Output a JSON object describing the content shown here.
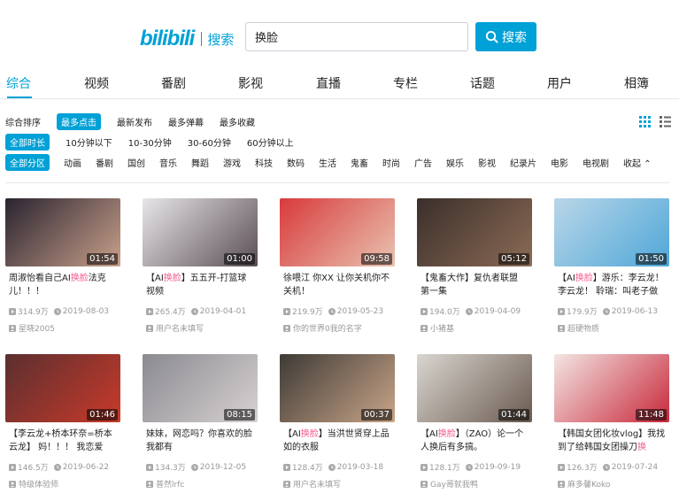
{
  "header": {
    "logo_text": "bilibili",
    "logo_suffix": "搜索",
    "search_value": "换脸",
    "search_button": "搜索"
  },
  "colors": {
    "accent": "#00a1d6",
    "highlight": "#f25d8e",
    "meta": "#999999"
  },
  "tabs": [
    {
      "label": "综合"
    },
    {
      "label": "视频"
    },
    {
      "label": "番剧"
    },
    {
      "label": "影视"
    },
    {
      "label": "直播"
    },
    {
      "label": "专栏"
    },
    {
      "label": "话题"
    },
    {
      "label": "用户"
    },
    {
      "label": "相簿"
    }
  ],
  "sort": [
    "综合排序",
    "最多点击",
    "最新发布",
    "最多弹幕",
    "最多收藏"
  ],
  "duration": [
    "全部时长",
    "10分钟以下",
    "10-30分钟",
    "30-60分钟",
    "60分钟以上"
  ],
  "categories": [
    "全部分区",
    "动画",
    "番剧",
    "国创",
    "音乐",
    "舞蹈",
    "游戏",
    "科技",
    "数码",
    "生活",
    "鬼畜",
    "时尚",
    "广告",
    "娱乐",
    "影视",
    "纪录片",
    "电影",
    "电视剧",
    "收起"
  ],
  "videos": [
    {
      "duration": "01:54",
      "title_pre": "周淑怡看自己AI",
      "title_hl": "换脸",
      "title_post": "法克儿！！！",
      "views": "314.9万",
      "date": "2019-08-03",
      "author": "星晓2005",
      "thumb_a": "#2a2430",
      "thumb_b": "#c9a08a"
    },
    {
      "duration": "01:00",
      "title_pre": "【AI",
      "title_hl": "换脸",
      "title_post": "】五五开-打篮球视频",
      "views": "265.4万",
      "date": "2019-04-01",
      "author": "用户名未填写",
      "thumb_a": "#e8e6ea",
      "thumb_b": "#5a4e55"
    },
    {
      "duration": "09:58",
      "title_pre": "徐喂江 你XX 让你关机你不关机！",
      "title_hl": "",
      "title_post": "",
      "views": "219.9万",
      "date": "2019-05-23",
      "author": "你的世界0我的名字",
      "thumb_a": "#d83a3c",
      "thumb_b": "#e9c3b0"
    },
    {
      "duration": "05:12",
      "title_pre": "【鬼畜大作】复仇者联盟 第一集",
      "title_hl": "",
      "title_post": "",
      "views": "194.0万",
      "date": "2019-04-09",
      "author": "小猪基",
      "thumb_a": "#3a2f2b",
      "thumb_b": "#8c6b55"
    },
    {
      "duration": "01:50",
      "title_pre": "【AI",
      "title_hl": "换脸",
      "title_post": "】游乐：李云龙！李云龙！ 聆瑞：叫老子做",
      "views": "179.9万",
      "date": "2019-06-13",
      "author": "超硬物质",
      "thumb_a": "#b9d6e8",
      "thumb_b": "#4fa7d8"
    },
    {
      "duration": "01:46",
      "title_pre": "【李云龙+桥本环奈=桥本云龙】 妈！！！ 我恋爱了!!!!!!",
      "title_hl": "",
      "title_post": "",
      "views": "146.5万",
      "date": "2019-06-22",
      "author": "特级体验师",
      "thumb_a": "#5b2f2f",
      "thumb_b": "#c93a2a"
    },
    {
      "duration": "08:15",
      "title_pre": "妹妹，网恋吗？你喜欢的脸我都有",
      "title_hl": "",
      "title_post": "",
      "views": "134.3万",
      "date": "2019-12-05",
      "author": "普然lrfc",
      "thumb_a": "#8a8a90",
      "thumb_b": "#d8d2d2"
    },
    {
      "duration": "00:37",
      "title_pre": "【AI",
      "title_hl": "换脸",
      "title_post": "】当洪世贤穿上品如的衣服",
      "views": "128.4万",
      "date": "2019-03-18",
      "author": "用户名未填写",
      "thumb_a": "#3e3a36",
      "thumb_b": "#c9a588"
    },
    {
      "duration": "01:44",
      "title_pre": "【AI",
      "title_hl": "换脸",
      "title_post": "】（ZAO）论一个人换后有多搞。",
      "views": "128.1万",
      "date": "2019-09-19",
      "author": "Gay哥就我鸭",
      "thumb_a": "#d9d6d0",
      "thumb_b": "#6b5a50"
    },
    {
      "duration": "11:48",
      "title_pre": "【韩国女团化妆vlog】我找到了给韩国女团操刀",
      "title_hl": "换",
      "title_post": "",
      "views": "126.3万",
      "date": "2019-07-24",
      "author": "麻多馨Koko",
      "thumb_a": "#f3e6e3",
      "thumb_b": "#c8283a"
    }
  ]
}
